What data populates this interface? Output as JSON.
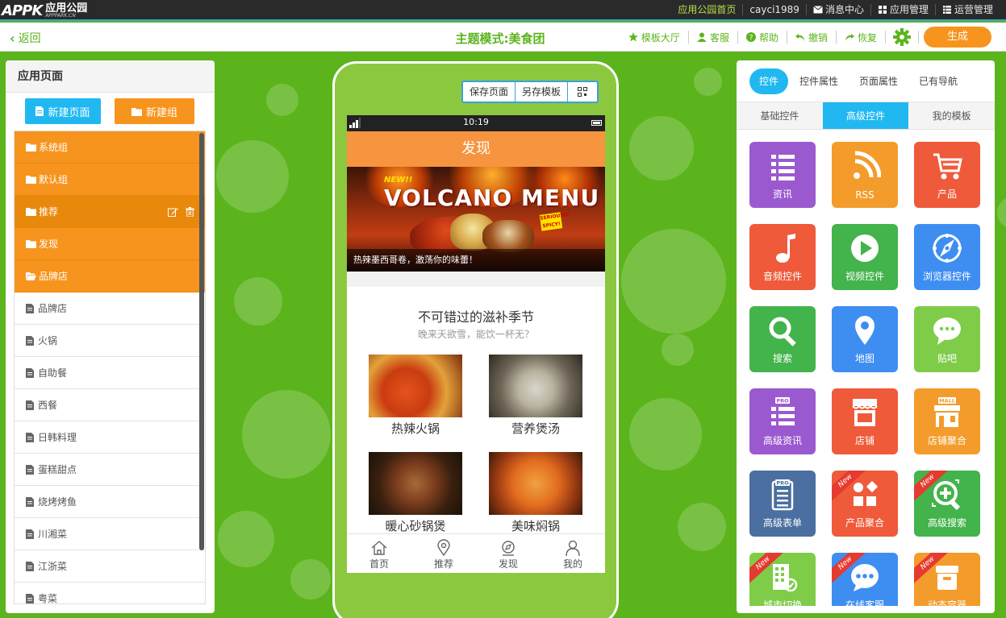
{
  "topbar": {
    "logo_mark": "APPK",
    "logo_cn": "应用公园",
    "logo_en": "APPPARK.CN",
    "nav": [
      {
        "label": "应用公园首页",
        "icon": ""
      },
      {
        "label": "cayci1989",
        "icon": ""
      },
      {
        "label": "消息中心",
        "icon": "envelope-icon"
      },
      {
        "label": "应用管理",
        "icon": "grid-icon"
      },
      {
        "label": "运营管理",
        "icon": "list-icon"
      }
    ]
  },
  "header": {
    "back_label": "返回",
    "title": "主题模式:美食团",
    "nav": [
      {
        "label": "模板大厅",
        "icon": "star-icon"
      },
      {
        "label": "客服",
        "icon": "user-icon"
      },
      {
        "label": "帮助",
        "icon": "question-icon"
      },
      {
        "label": "撤销",
        "icon": "undo-icon"
      },
      {
        "label": "恢复",
        "icon": "redo-icon"
      }
    ],
    "generate_label": "生成"
  },
  "left_panel": {
    "title": "应用页面",
    "new_page_label": "新建页面",
    "new_group_label": "新建组",
    "groups": [
      {
        "label": "系统组",
        "active": false
      },
      {
        "label": "默认组",
        "active": false
      },
      {
        "label": "推荐",
        "active": true
      },
      {
        "label": "发现",
        "active": false
      },
      {
        "label": "品牌店",
        "active": false
      }
    ],
    "pages": [
      "品牌店",
      "火锅",
      "自助餐",
      "西餐",
      "日韩料理",
      "蛋糕甜点",
      "烧烤烤鱼",
      "川湘菜",
      "江浙菜",
      "粤菜"
    ]
  },
  "phone": {
    "tools": [
      "保存页面",
      "另存模板"
    ],
    "status_time": "10:19",
    "app_title": "发现",
    "banner": {
      "new_tag": "NEW!!",
      "headline": "VOLCANO MENU",
      "badge": "SERIOUSLY SPICY!",
      "caption": "热辣墨西哥卷，激荡你的味蕾！"
    },
    "section_title": "不可错过的滋补季节",
    "section_sub": "晚来天欲雪，能饮一杯无？",
    "items": [
      {
        "label": "热辣火锅"
      },
      {
        "label": "营养煲汤"
      },
      {
        "label": "暖心砂锅煲"
      },
      {
        "label": "美味焖锅"
      }
    ],
    "tabs": [
      {
        "label": "首页",
        "icon": "home-icon"
      },
      {
        "label": "推荐",
        "icon": "location-pin-icon"
      },
      {
        "label": "发现",
        "icon": "compass-icon"
      },
      {
        "label": "我的",
        "icon": "person-icon"
      }
    ]
  },
  "right_panel": {
    "tabs": [
      "控件",
      "控件属性",
      "页面属性",
      "已有导航"
    ],
    "subtabs": [
      "基础控件",
      "高级控件",
      "我的模板"
    ],
    "active_subtab": "高级控件",
    "controls": [
      {
        "label": "资讯",
        "color": "#9b59d0",
        "icon": "list-icon",
        "new": false
      },
      {
        "label": "RSS",
        "color": "#f39c2b",
        "icon": "rss-icon",
        "new": false
      },
      {
        "label": "产品",
        "color": "#ef5a3a",
        "icon": "cart-icon",
        "new": false
      },
      {
        "label": "音频控件",
        "color": "#ef5a3a",
        "icon": "music-note-icon",
        "new": false
      },
      {
        "label": "视频控件",
        "color": "#43b34b",
        "icon": "play-icon",
        "new": false
      },
      {
        "label": "浏览器控件",
        "color": "#3e8ef2",
        "icon": "compass-icon",
        "new": false
      },
      {
        "label": "搜索",
        "color": "#43b34b",
        "icon": "search-icon",
        "new": false
      },
      {
        "label": "地图",
        "color": "#3e8ef2",
        "icon": "map-pin-icon",
        "new": false
      },
      {
        "label": "贴吧",
        "color": "#7fcc48",
        "icon": "chat-bubble-icon",
        "new": false
      },
      {
        "label": "高级资讯",
        "color": "#9b59d0",
        "icon": "pro-list-icon",
        "new": false
      },
      {
        "label": "店铺",
        "color": "#ef5a3a",
        "icon": "store-icon",
        "new": false
      },
      {
        "label": "店铺聚合",
        "color": "#f39c2b",
        "icon": "mall-icon",
        "new": false
      },
      {
        "label": "高级表单",
        "color": "#4a6fa0",
        "icon": "pro-form-icon",
        "new": false
      },
      {
        "label": "产品聚合",
        "color": "#ef5a3a",
        "icon": "shapes-icon",
        "new": true
      },
      {
        "label": "高级搜索",
        "color": "#43b34b",
        "icon": "zoom-plus-icon",
        "new": true
      },
      {
        "label": "城市切换",
        "color": "#7fcc48",
        "icon": "building-icon",
        "new": true
      },
      {
        "label": "在线客服",
        "color": "#3e8ef2",
        "icon": "chat-dots-icon",
        "new": true
      },
      {
        "label": "动态容器",
        "color": "#f39c2b",
        "icon": "box-icon",
        "new": true
      }
    ],
    "new_tag": "New"
  }
}
